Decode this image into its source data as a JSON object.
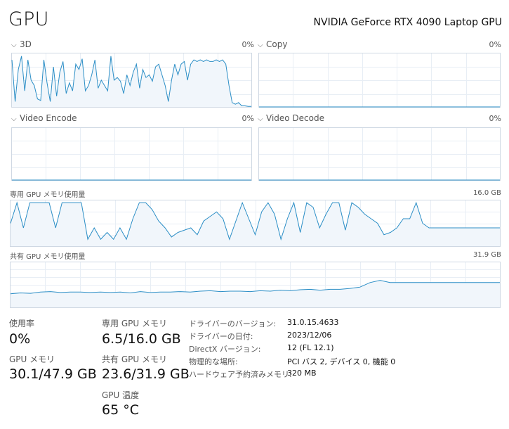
{
  "header": {
    "title": "GPU",
    "gpu_name": "NVIDIA GeForce RTX 4090 Laptop GPU"
  },
  "engines": [
    {
      "label": "3D",
      "value": "0%"
    },
    {
      "label": "Copy",
      "value": "0%"
    },
    {
      "label": "Video Encode",
      "value": "0%"
    },
    {
      "label": "Video Decode",
      "value": "0%"
    }
  ],
  "dedicated_mem_graph": {
    "label": "専用 GPU メモリ使用量",
    "max": "16.0 GB"
  },
  "shared_mem_graph": {
    "label": "共有 GPU メモリ使用量",
    "max": "31.9 GB"
  },
  "stats": {
    "utilization": {
      "label": "使用率",
      "value": "0%"
    },
    "dedicated_mem": {
      "label": "専用 GPU メモリ",
      "value": "6.5/16.0 GB"
    },
    "gpu_mem": {
      "label": "GPU メモリ",
      "value": "30.1/47.9 GB"
    },
    "shared_mem": {
      "label": "共有 GPU メモリ",
      "value": "23.6/31.9 GB"
    },
    "temperature": {
      "label": "GPU 温度",
      "value": "65 °C"
    }
  },
  "details": [
    {
      "key": "ドライバーのバージョン:",
      "value": "31.0.15.4633"
    },
    {
      "key": "ドライバーの日付:",
      "value": "2023/12/06"
    },
    {
      "key": "DirectX バージョン:",
      "value": "12 (FL 12.1)"
    },
    {
      "key": "物理的な場所:",
      "value": "PCI バス 2, デバイス 0, 機能 0"
    },
    {
      "key": "ハードウェア予約済みメモリ:",
      "value": "320 MB"
    }
  ],
  "series": {
    "3d": [
      88,
      10,
      70,
      95,
      30,
      88,
      50,
      40,
      15,
      12,
      88,
      45,
      10,
      75,
      20,
      65,
      85,
      25,
      45,
      30,
      80,
      70,
      90,
      30,
      40,
      60,
      88,
      35,
      50,
      40,
      30,
      95,
      50,
      55,
      48,
      25,
      60,
      40,
      65,
      80,
      35,
      70,
      55,
      60,
      48,
      75,
      80,
      60,
      40,
      10,
      50,
      80,
      60,
      80,
      85,
      50,
      80,
      88,
      85,
      88,
      85,
      88,
      85,
      85,
      88,
      85,
      88,
      80,
      40,
      8,
      5,
      8,
      2,
      2,
      1,
      1
    ],
    "copy": [
      0,
      0
    ],
    "video_encode": [
      0,
      0
    ],
    "video_decode": [
      0,
      0
    ],
    "dedicated_mem": [
      50,
      95,
      40,
      95,
      95,
      95,
      95,
      40,
      95,
      95,
      95,
      95,
      15,
      40,
      15,
      30,
      15,
      40,
      15,
      60,
      95,
      95,
      80,
      55,
      40,
      20,
      30,
      35,
      40,
      25,
      55,
      65,
      75,
      60,
      15,
      55,
      95,
      60,
      25,
      75,
      95,
      70,
      15,
      60,
      95,
      30,
      95,
      85,
      40,
      70,
      95,
      95,
      35,
      95,
      85,
      70,
      60,
      50,
      25,
      30,
      40,
      60,
      60,
      95,
      50,
      40,
      40,
      40,
      40,
      40,
      40,
      40,
      40,
      40,
      40,
      40,
      40
    ],
    "shared_mem": [
      30,
      32,
      31,
      34,
      35,
      33,
      34,
      34,
      33,
      34,
      33,
      34,
      32,
      35,
      33,
      34,
      34,
      35,
      34,
      36,
      37,
      35,
      36,
      36,
      35,
      37,
      36,
      38,
      37,
      39,
      40,
      38,
      40,
      40,
      42,
      45,
      55,
      60,
      55,
      55,
      55,
      55,
      55,
      55,
      55,
      55,
      55,
      55,
      55,
      55
    ]
  }
}
